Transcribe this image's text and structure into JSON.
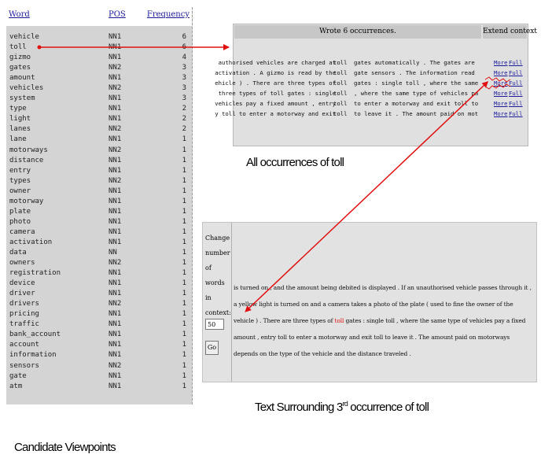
{
  "word_table": {
    "headers": {
      "word": "Word",
      "pos": "POS",
      "frequency": "Frequency"
    },
    "rows": [
      {
        "word": "vehicle",
        "pos": "NN1",
        "freq": "6"
      },
      {
        "word": "toll",
        "pos": "NN1",
        "freq": "6"
      },
      {
        "word": "gizmo",
        "pos": "NN1",
        "freq": "4"
      },
      {
        "word": "gates",
        "pos": "NN2",
        "freq": "3"
      },
      {
        "word": "amount",
        "pos": "NN1",
        "freq": "3"
      },
      {
        "word": "vehicles",
        "pos": "NN2",
        "freq": "3"
      },
      {
        "word": "system",
        "pos": "NN1",
        "freq": "3"
      },
      {
        "word": "type",
        "pos": "NN1",
        "freq": "2"
      },
      {
        "word": "light",
        "pos": "NN1",
        "freq": "2"
      },
      {
        "word": "lanes",
        "pos": "NN2",
        "freq": "2"
      },
      {
        "word": "lane",
        "pos": "NN1",
        "freq": "1"
      },
      {
        "word": "motorways",
        "pos": "NN2",
        "freq": "1"
      },
      {
        "word": "distance",
        "pos": "NN1",
        "freq": "1"
      },
      {
        "word": "entry",
        "pos": "NN1",
        "freq": "1"
      },
      {
        "word": "types",
        "pos": "NN2",
        "freq": "1"
      },
      {
        "word": "owner",
        "pos": "NN1",
        "freq": "1"
      },
      {
        "word": "motorway",
        "pos": "NN1",
        "freq": "1"
      },
      {
        "word": "plate",
        "pos": "NN1",
        "freq": "1"
      },
      {
        "word": "photo",
        "pos": "NN1",
        "freq": "1"
      },
      {
        "word": "camera",
        "pos": "NN1",
        "freq": "1"
      },
      {
        "word": "activation",
        "pos": "NN1",
        "freq": "1"
      },
      {
        "word": "data",
        "pos": "NN",
        "freq": "1"
      },
      {
        "word": "owners",
        "pos": "NN2",
        "freq": "1"
      },
      {
        "word": "registration",
        "pos": "NN1",
        "freq": "1"
      },
      {
        "word": "device",
        "pos": "NN1",
        "freq": "1"
      },
      {
        "word": "driver",
        "pos": "NN1",
        "freq": "1"
      },
      {
        "word": "drivers",
        "pos": "NN2",
        "freq": "1"
      },
      {
        "word": "pricing",
        "pos": "NN1",
        "freq": "1"
      },
      {
        "word": "traffic",
        "pos": "NN1",
        "freq": "1"
      },
      {
        "word": "bank_account",
        "pos": "NN1",
        "freq": "1"
      },
      {
        "word": "account",
        "pos": "NN1",
        "freq": "1"
      },
      {
        "word": "information",
        "pos": "NN1",
        "freq": "1"
      },
      {
        "word": "sensors",
        "pos": "NN2",
        "freq": "1"
      },
      {
        "word": "gate",
        "pos": "NN1",
        "freq": "1"
      },
      {
        "word": "atm",
        "pos": "NN1",
        "freq": "1"
      }
    ]
  },
  "occurrences": {
    "header": "Wrote 6 occurrences.",
    "extend_header": "Extend context",
    "rows": [
      {
        "left": "authorised vehicles are charged at",
        "key": "toll",
        "right": "gates automatically . The gates are",
        "more": "More",
        "full": "Full"
      },
      {
        "left": "activation . A gizmo is read by the",
        "key": "toll",
        "right": "gate sensors . The information read",
        "more": "More",
        "full": "Full"
      },
      {
        "left": "ehicle ) . There are three types of",
        "key": "toll",
        "right": "gates : single toll , where the same",
        "more": "More",
        "full": "Full"
      },
      {
        "left": "three types of toll gates : single",
        "key": "toll",
        "right": ", where the same type of vehicles pa",
        "more": "More",
        "full": "Full"
      },
      {
        "left": "vehicles pay a fixed amount , entry",
        "key": "toll",
        "right": "to enter a motorway and exit toll to",
        "more": "More",
        "full": "Full"
      },
      {
        "left": "y toll to enter a motorway and exit",
        "key": "toll",
        "right": "to leave it . The amount paid on mot",
        "more": "More",
        "full": "Full"
      }
    ]
  },
  "context": {
    "side_label": "Change number of words in context:",
    "words_value": "50",
    "go_label": "Go",
    "text_before": "is turned on , and the amount being debited is displayed . If an unauthorised vehicle passes through it , a yellow light is turned on and a camera takes a photo of the plate ( used to fine the owner of the vehicle ) . There are three types of ",
    "keyword": "toll",
    "text_after": " gates : single toll , where the same type of vehicles pay a fixed amount , entry toll to enter a motorway and exit toll to leave it . The amount paid on motorways depends on the type of the vehicle and the distance traveled ."
  },
  "captions": {
    "occurrences": "All occurrences of toll",
    "context_prefix": "Text Surrounding 3",
    "context_sup": "rd",
    "context_suffix": " occurrence of toll",
    "candidates": "Candidate Viewpoints"
  },
  "colors": {
    "arrow": "#e01010",
    "link": "#1a1a9a",
    "panel": "#d4d4d4"
  }
}
